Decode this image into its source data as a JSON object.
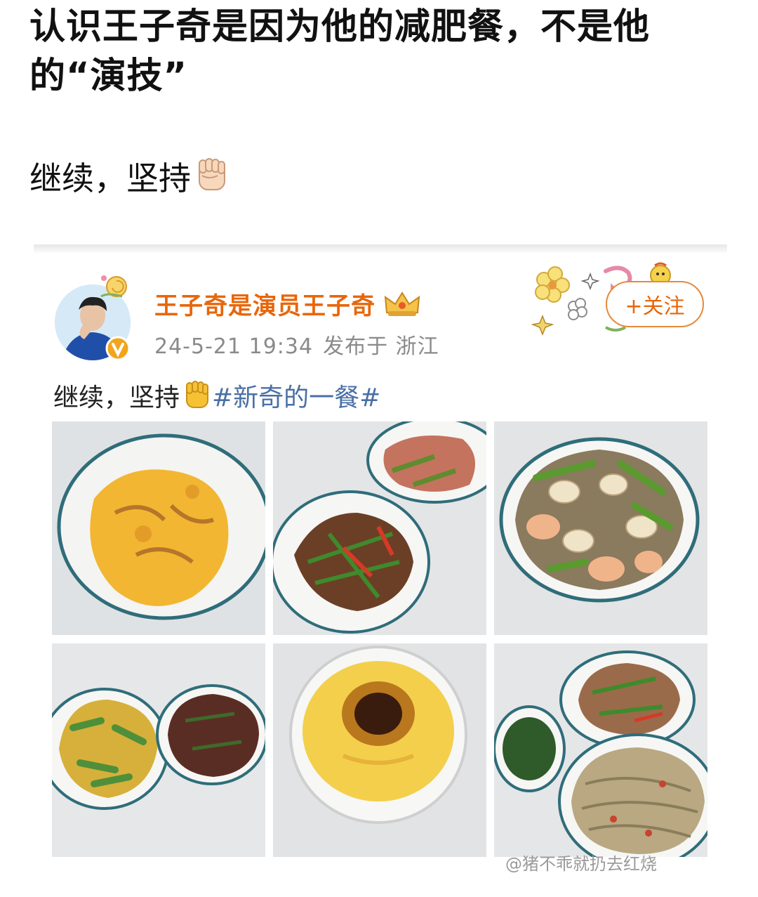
{
  "post": {
    "title": "认识王子奇是因为他的减肥餐，不是他的“演技”",
    "body": "继续，坚持"
  },
  "embedded": {
    "username": "王子奇是演员王子奇",
    "date": "24-5-21 19:34",
    "published": "发布于 浙江",
    "follow_label": "+关注",
    "text": "继续，坚持",
    "hashtag": "#新奇的一餐#"
  },
  "photos": [
    {
      "icon": "scrambled-eggs-photo"
    },
    {
      "icon": "stir-fried-beef-and-bacon-photo"
    },
    {
      "icon": "mushroom-vegetable-stirfry-photo"
    },
    {
      "icon": "cucumber-egg-and-beef-photo"
    },
    {
      "icon": "steamed-egg-custard-photo"
    },
    {
      "icon": "noodles-greens-and-stirfry-photo"
    }
  ],
  "watermark": "@猪不乖就扔去红烧",
  "colors": {
    "username": "#e8660a",
    "hashtag": "#4a6fa5",
    "meta": "#8a8a8a"
  }
}
